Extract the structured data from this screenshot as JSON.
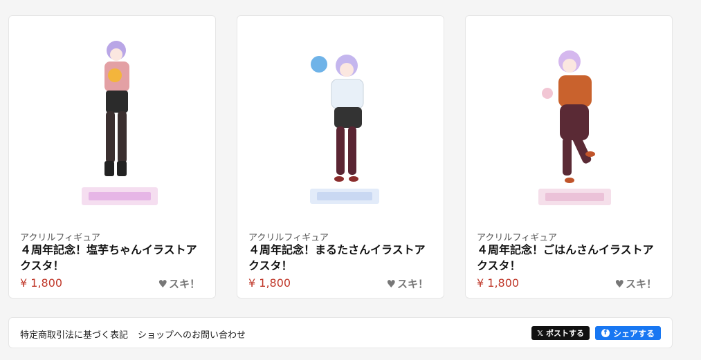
{
  "products": [
    {
      "category": "アクリルフィギュア",
      "title": "４周年記念！塩芋ちゃんイラストアクスタ！",
      "price": "¥ 1,800",
      "like_label": "スキ！",
      "image": {
        "hair": "#b9a6e6",
        "top": "#e3a0a4",
        "bottom": "#2b2b2b",
        "legs": "#3a2f2f",
        "prop": "#f3b53c"
      }
    },
    {
      "category": "アクリルフィギュア",
      "title": "４周年記念！まるたさんイラストアクスタ！",
      "price": "¥ 1,800",
      "like_label": "スキ！",
      "image": {
        "hair": "#c4b6ee",
        "top": "#e8f0f8",
        "bottom": "#333333",
        "legs": "#5a2533",
        "prop": "#6fb3e8"
      }
    },
    {
      "category": "アクリルフィギュア",
      "title": "４周年記念！ごはんさんイラストアクスタ！",
      "price": "¥ 1,800",
      "like_label": "スキ！",
      "image": {
        "hair": "#d5b8ee",
        "top": "#c9622d",
        "bottom": "#5a2a35",
        "legs": "#5a2a35",
        "prop": "#f2c6d4"
      }
    }
  ],
  "footer": {
    "tokushoho_link": "特定商取引法に基づく表記",
    "contact_link": "ショップへのお問い合わせ",
    "x_post_label": "ポストする",
    "fb_share_label": "シェアする"
  },
  "icons": {
    "like": "heart-icon",
    "x": "x-logo-icon",
    "facebook": "facebook-icon"
  }
}
